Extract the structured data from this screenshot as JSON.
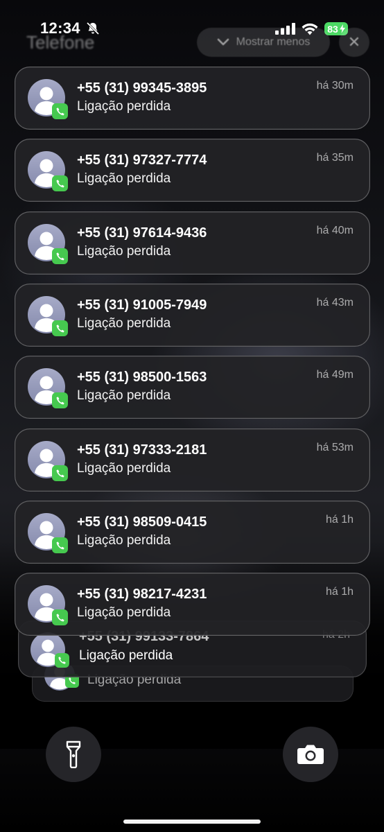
{
  "status": {
    "time": "12:34",
    "battery": "83"
  },
  "header": {
    "app_title": "Telefone",
    "show_less": "Mostrar menos",
    "close": "✕"
  },
  "notifications": [
    {
      "title": "+55 (31) 99345-3895",
      "body": "Ligação perdida",
      "time": "há 30m"
    },
    {
      "title": "+55 (31) 97327-7774",
      "body": "Ligação perdida",
      "time": "há 35m"
    },
    {
      "title": "+55 (31) 97614-9436",
      "body": "Ligação perdida",
      "time": "há 40m"
    },
    {
      "title": "+55 (31) 91005-7949",
      "body": "Ligação perdida",
      "time": "há 43m"
    },
    {
      "title": "+55 (31) 98500-1563",
      "body": "Ligação perdida",
      "time": "há 49m"
    },
    {
      "title": "+55 (31) 97333-2181",
      "body": "Ligação perdida",
      "time": "há 53m"
    },
    {
      "title": "+55 (31) 98509-0415",
      "body": "Ligação perdida",
      "time": "há 1h"
    },
    {
      "title": "+55 (31) 98217-4231",
      "body": "Ligação perdida",
      "time": "há 1h"
    }
  ],
  "stacked": [
    {
      "title": "+55 (31) 99133-7864",
      "body": "Ligação perdida",
      "time": "há 2h"
    },
    {
      "body": "Ligação perdida"
    }
  ],
  "bottom": {
    "flashlight_icon": "flashlight-icon",
    "camera_icon": "camera-icon"
  },
  "colors": {
    "badge_green": "#46c94f",
    "battery_green": "#4cd964"
  }
}
